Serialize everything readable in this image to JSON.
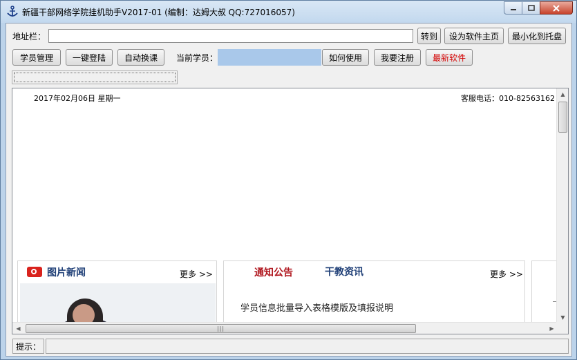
{
  "window": {
    "title": "新疆干部网络学院挂机助手V2017-01 (编制：达姆大叔 QQ:727016057)"
  },
  "addressbar": {
    "label": "地址栏：",
    "value": "",
    "go_label": "转到",
    "set_home_label": "设为软件主页",
    "minimize_tray_label": "最小化到托盘"
  },
  "toolbar": {
    "student_manage": "学员管理",
    "one_click_login": "一键登陆",
    "auto_switch": "自动换课",
    "current_student_label": "当前学员：",
    "current_student_value": "",
    "how_to_use": "如何使用",
    "register": "我要注册",
    "latest_software": "最新软件"
  },
  "browser": {
    "date": "2017年02月06日 星期一",
    "phone": "客服电话：010-82563162",
    "pic_news": {
      "title": "图片新闻",
      "more": "更多 >>"
    },
    "notice_panel": {
      "tab_notice": "通知公告",
      "tab_news": "干教资讯",
      "more": "更多 >>",
      "items": [
        "学员信息批量导入表格模版及填报说明"
      ]
    }
  },
  "status": {
    "label": "提示：",
    "value": ""
  },
  "colors": {
    "accent_red": "#d40000",
    "heading_blue": "#1f3f77",
    "student_field": "#a9c8ea"
  }
}
